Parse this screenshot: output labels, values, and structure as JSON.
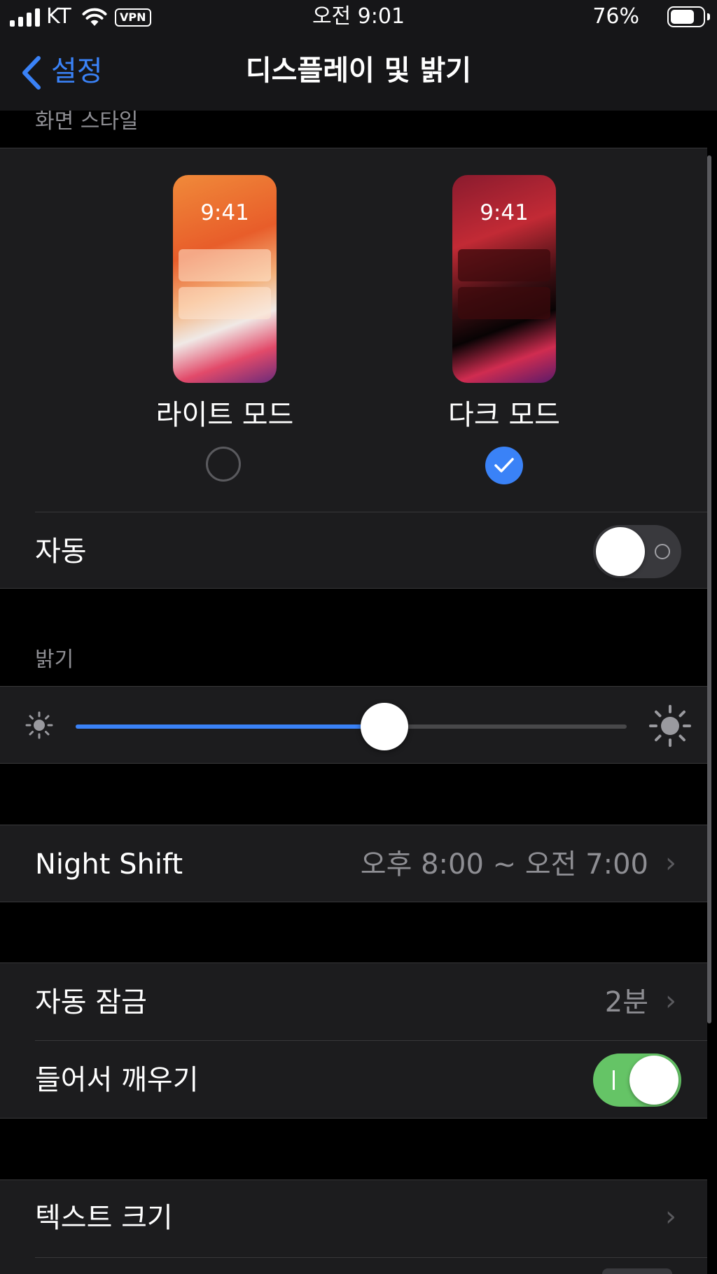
{
  "status_bar": {
    "carrier": "KT",
    "vpn": "VPN",
    "time": "오전 9:01",
    "battery_percent": "76%",
    "battery_level": 0.76
  },
  "nav": {
    "back_label": "설정",
    "title": "디스플레이 및 밝기"
  },
  "appearance": {
    "header": "화면 스타일",
    "light": {
      "label": "라이트 모드",
      "preview_time": "9:41",
      "selected": false
    },
    "dark": {
      "label": "다크 모드",
      "preview_time": "9:41",
      "selected": true
    },
    "auto": {
      "label": "자동",
      "on": false
    }
  },
  "brightness": {
    "header": "밝기",
    "level": 0.56
  },
  "night_shift": {
    "label": "Night Shift",
    "value": "오후 8:00 ~ 오전 7:00"
  },
  "auto_lock": {
    "label": "자동 잠금",
    "value": "2분"
  },
  "raise_to_wake": {
    "label": "들어서 깨우기",
    "on": true
  },
  "text_size": {
    "label": "텍스트 크기"
  },
  "colors": {
    "accent": "#3a82f7",
    "toggle_on": "#65c466",
    "toggle_off": "#39393d",
    "panel": "#1c1c1e",
    "separator": "#38383a"
  }
}
